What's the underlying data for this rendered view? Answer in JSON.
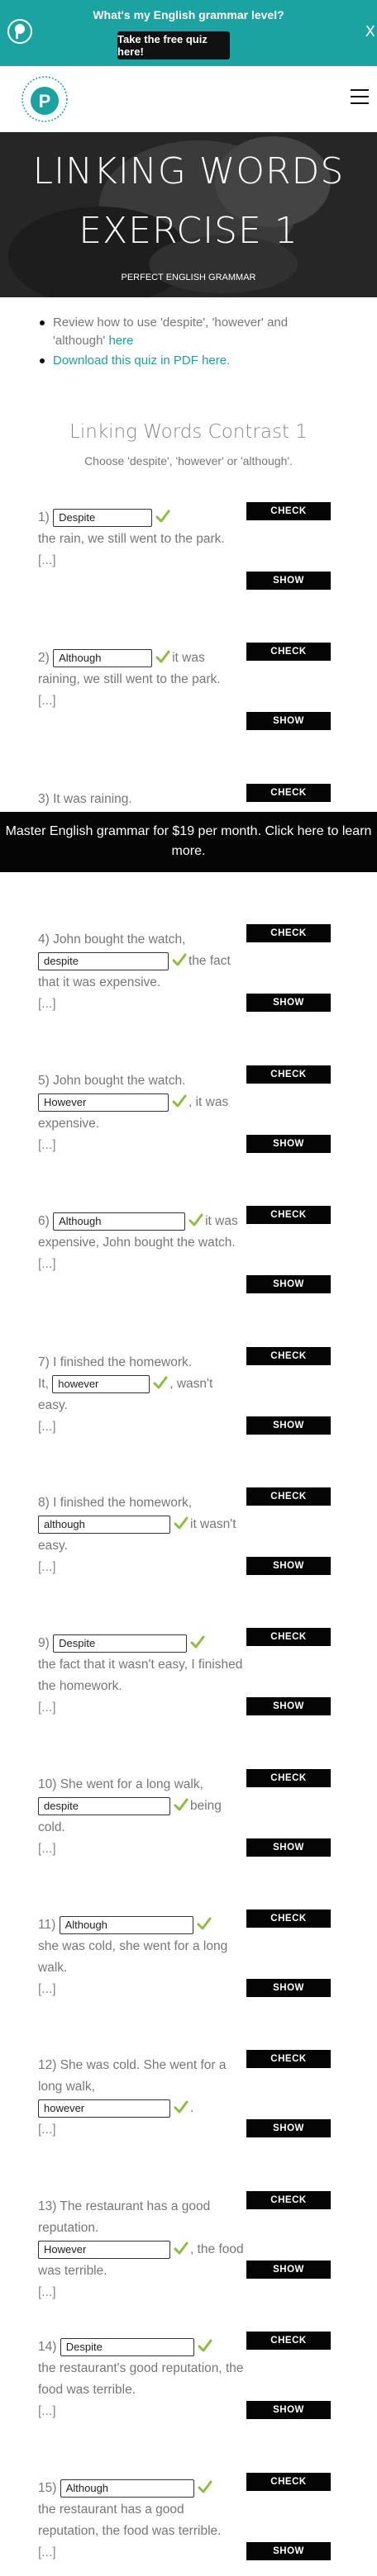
{
  "promo": {
    "question": "What's my English grammar level?",
    "button": "Take the free quiz here!",
    "close": "X"
  },
  "hero": {
    "title_line1": "LINKING WORDS",
    "title_line2": "EXERCISE 1",
    "site_name": "PERFECT ENGLISH GRAMMAR"
  },
  "intro": {
    "item1_text": "Review how to use 'despite', 'however' and 'although' ",
    "item1_link": "here",
    "item2_link": "Download this quiz in PDF here."
  },
  "quiz": {
    "title": "Linking Words Contrast 1",
    "subtitle": "Choose 'despite', 'however' or 'although'.",
    "check_label": "CHECK",
    "show_label": "SHOW",
    "ellipsis": "[...]",
    "questions": [
      {
        "pre": "1)",
        "answer": "Despite",
        "post": "the rain, we still went to the park."
      },
      {
        "pre": "2)",
        "answer": "Although",
        "post": "it was raining, we still went to the park."
      },
      {
        "pre": "3) It was raining.",
        "answer": "",
        "post": ""
      },
      {
        "pre": "4) John bought the watch,",
        "answer": "despite",
        "post": "the fact that it was expensive."
      },
      {
        "pre": "5) John bought the watch.",
        "answer": "However",
        "post": ", it was expensive."
      },
      {
        "pre": "6)",
        "answer": "Although",
        "post": "it was expensive, John bought the watch."
      },
      {
        "pre": "7) I finished the homework.",
        "pre2": "It,",
        "answer": "however",
        "post": ", wasn't easy."
      },
      {
        "pre": "8) I finished the homework,",
        "answer": "although",
        "post": "it wasn't easy."
      },
      {
        "pre": "9)",
        "answer": "Despite",
        "post": "the fact that it wasn't easy, I finished the homework."
      },
      {
        "pre": "10) She went for a long walk,",
        "answer": "despite",
        "post": "being cold."
      },
      {
        "pre": "11)",
        "answer": "Although",
        "post": "she was cold, she went for a long walk."
      },
      {
        "pre": "12) She was cold. She went for a long walk,",
        "answer": "however",
        "post": "."
      },
      {
        "pre": "13) The restaurant has a good reputation.",
        "answer": "However",
        "post": ", the food was terrible."
      },
      {
        "pre": "14)",
        "answer": "Despite",
        "post": "the restaurant's good reputation, the food was terrible."
      },
      {
        "pre": "15)",
        "answer": "Although",
        "post": "the restaurant has a good reputation, the food was terrible."
      }
    ]
  },
  "banner": {
    "text": "Master English grammar for $19 per month. Click here to learn more."
  },
  "colors": {
    "brand_teal": "#1aa3a0",
    "tick_green": "#8cbf3f",
    "button_black": "#050505"
  },
  "icons": [
    "logo-icon",
    "menu-icon",
    "checkmark-icon",
    "close-icon"
  ]
}
